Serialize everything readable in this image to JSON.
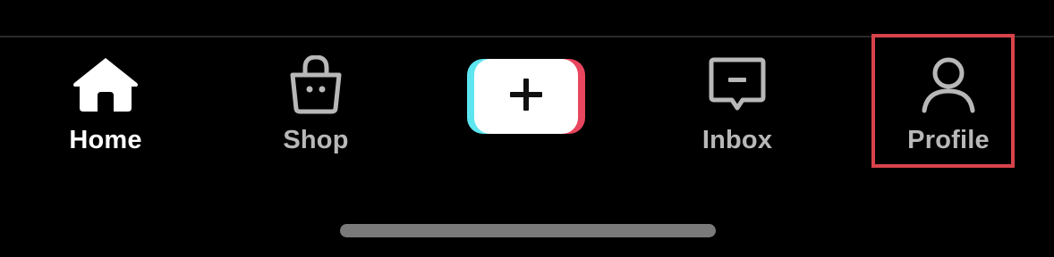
{
  "nav": {
    "items": [
      {
        "label": "Home",
        "icon": "home-icon",
        "active": true
      },
      {
        "label": "Shop",
        "icon": "shopping-bag-icon",
        "active": false
      },
      {
        "label": "Inbox",
        "icon": "inbox-message-icon",
        "active": false
      },
      {
        "label": "Profile",
        "icon": "person-icon",
        "active": false,
        "highlighted": true
      }
    ],
    "create": {
      "icon": "plus-icon"
    }
  },
  "colors": {
    "background": "#000000",
    "active_label": "#ffffff",
    "inactive_label": "#b8b8b8",
    "create_cyan": "#5ee6f0",
    "create_red": "#e8455e",
    "highlight_border": "#d8434a",
    "home_indicator": "#7a7a7a"
  }
}
